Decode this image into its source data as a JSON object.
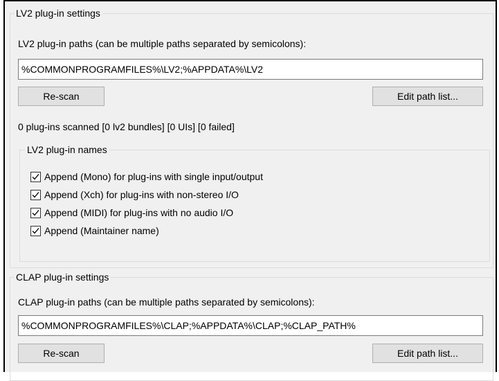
{
  "lv2": {
    "group_title": "LV2 plug-in settings",
    "paths_label": "LV2 plug-in paths (can be multiple paths separated by semicolons):",
    "paths_value": "%COMMONPROGRAMFILES%\\LV2;%APPDATA%\\LV2",
    "rescan_label": "Re-scan",
    "edit_path_label": "Edit path list...",
    "scan_status": "0 plug-ins scanned [0 lv2 bundles] [0 UIs] [0 failed]",
    "names_group_title": "LV2 plug-in names",
    "options": [
      {
        "label": "Append (Mono) for plug-ins with single input/output",
        "checked": true
      },
      {
        "label": "Append (Xch) for plug-ins with non-stereo I/O",
        "checked": true
      },
      {
        "label": "Append (MIDI) for plug-ins with no audio I/O",
        "checked": true
      },
      {
        "label": "Append (Maintainer name)",
        "checked": true
      }
    ]
  },
  "clap": {
    "group_title": "CLAP plug-in settings",
    "paths_label": "CLAP plug-in paths (can be multiple paths separated by semicolons):",
    "paths_value": "%COMMONPROGRAMFILES%\\CLAP;%APPDATA%\\CLAP;%CLAP_PATH%",
    "rescan_label": "Re-scan",
    "edit_path_label": "Edit path list..."
  }
}
